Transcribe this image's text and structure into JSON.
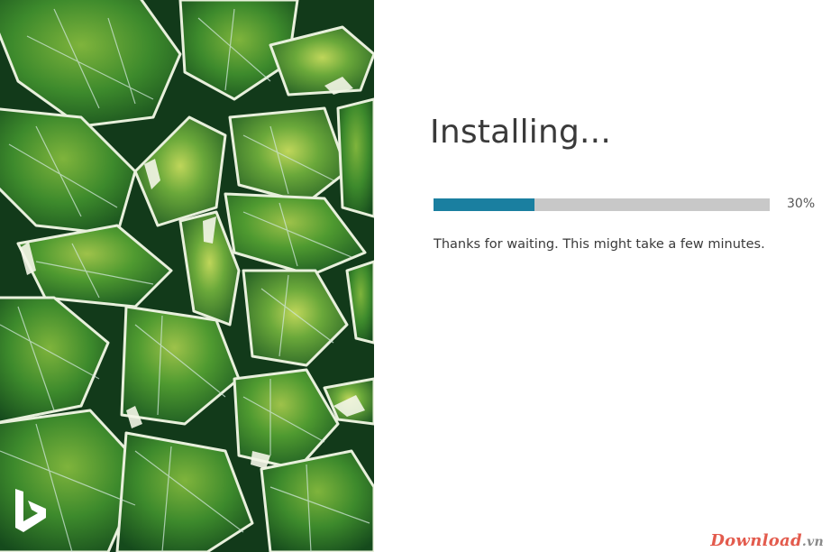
{
  "window": {
    "title": "Installing...",
    "background_image": "succulent-leaves-photo",
    "logo": "bing-icon"
  },
  "progress": {
    "percent": 30,
    "label": "30%",
    "accent_color": "#1a7fa0",
    "track_color": "#c8c8c8"
  },
  "status": {
    "message": "Thanks for waiting. This might take a few minutes."
  },
  "watermark": {
    "brand": "Download",
    "suffix": ".vn",
    "color": "#e35b4d"
  }
}
